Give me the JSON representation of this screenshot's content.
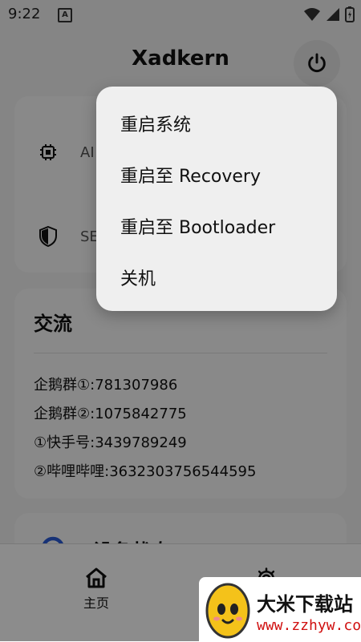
{
  "status": {
    "time": "9:22",
    "a_icon_text": "A"
  },
  "appbar": {
    "title": "Xadkern"
  },
  "card1": {
    "row1_label": "AI",
    "row2_label": "SE"
  },
  "card2": {
    "title": "交流",
    "lines": [
      "企鹅群①:781307986",
      "企鹅群②:1075842775",
      "①快手号:3439789249",
      "②哔哩哔哩:3632303756544595"
    ]
  },
  "card3": {
    "title": "设备状态"
  },
  "bottom_nav": {
    "home_label": "主页"
  },
  "menu": {
    "items": [
      "重启系统",
      "重启至 Recovery",
      "重启至 Bootloader",
      "关机"
    ]
  },
  "watermark": {
    "title": "大米下载站",
    "url": "www.zzhyw.com"
  },
  "colors": {
    "scrim": "#000000",
    "watermark_url": "#d01010"
  }
}
